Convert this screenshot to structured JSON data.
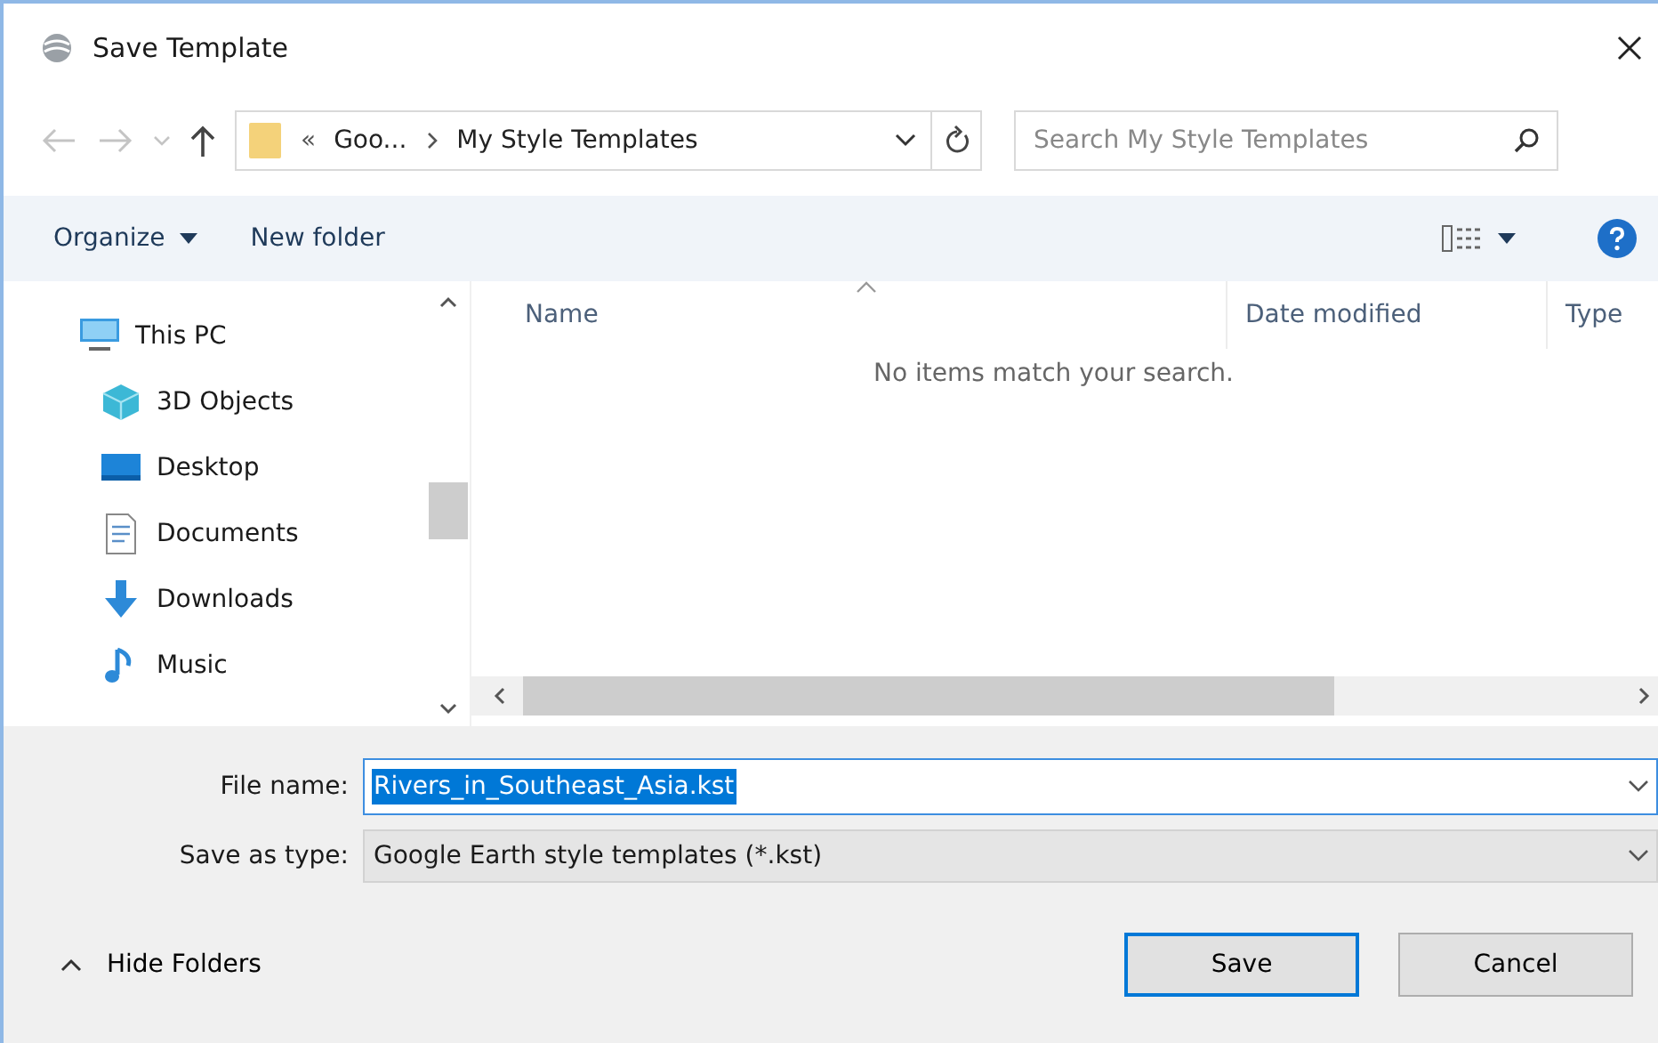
{
  "window": {
    "title": "Save Template"
  },
  "address_bar": {
    "overflow": "«",
    "crumbs": [
      {
        "label": "Goo..."
      },
      {
        "label": "My Style Templates"
      }
    ]
  },
  "search": {
    "placeholder": "Search My Style Templates"
  },
  "command_bar": {
    "organize": "Organize",
    "new_folder": "New folder"
  },
  "sidebar": {
    "items": [
      {
        "label": "This PC",
        "kind": "pc",
        "children": [
          {
            "label": "3D Objects",
            "kind": "cube"
          },
          {
            "label": "Desktop",
            "kind": "desktop"
          },
          {
            "label": "Documents",
            "kind": "document"
          },
          {
            "label": "Downloads",
            "kind": "download"
          },
          {
            "label": "Music",
            "kind": "music"
          }
        ]
      }
    ]
  },
  "table": {
    "columns": [
      "Name",
      "Date modified",
      "Type"
    ],
    "empty_message": "No items match your search."
  },
  "file_name": {
    "label": "File name:",
    "value": "Rivers_in_Southeast_Asia.kst",
    "selected": true
  },
  "save_as_type": {
    "label": "Save as type:",
    "value": "Google Earth style templates (*.kst)"
  },
  "hide_folders": "Hide Folders",
  "buttons": [
    {
      "label": "Save",
      "default": true
    },
    {
      "label": "Cancel",
      "default": false
    }
  ]
}
